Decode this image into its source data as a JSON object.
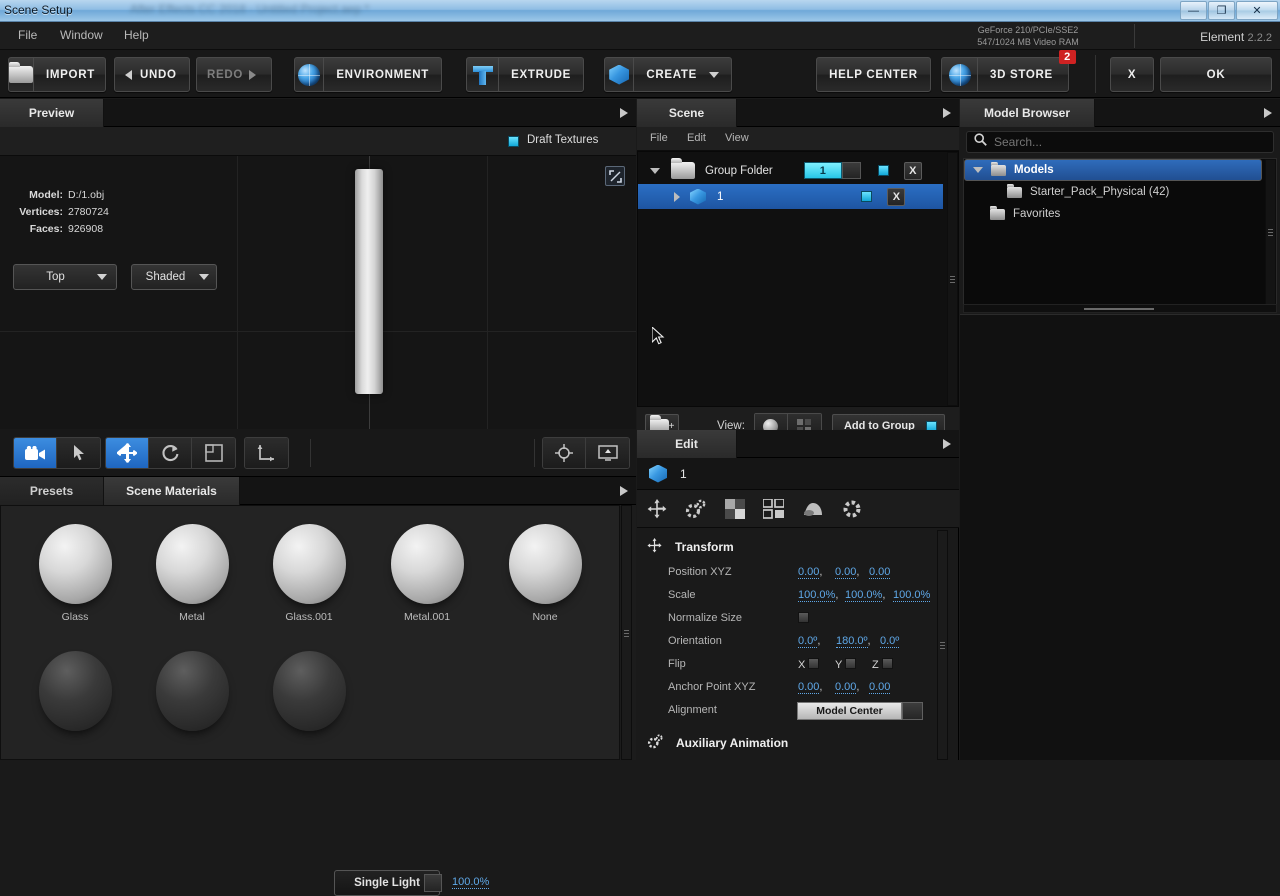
{
  "window": {
    "title": "Scene Setup",
    "ghost_title": "After Effects CC 2018 - Untitled Project.aep *",
    "minimize": "—",
    "maximize": "❐",
    "close": "✕"
  },
  "menubar": {
    "items": [
      "File",
      "Window",
      "Help"
    ]
  },
  "gpu": {
    "line1": "GeForce 210/PCIe/SSE2",
    "line2": "547/1024 MB Video RAM"
  },
  "product": {
    "name": "Element",
    "version": "2.2.2"
  },
  "toolbar": {
    "import": "IMPORT",
    "undo": "UNDO",
    "redo": "REDO",
    "environment": "ENVIRONMENT",
    "extrude": "EXTRUDE",
    "create": "CREATE",
    "help_center": "HELP CENTER",
    "store": "3D STORE",
    "store_badge": "2",
    "cancel": "X",
    "ok": "OK"
  },
  "preview": {
    "tab": "Preview",
    "draft_textures_label": "Draft Textures",
    "draft_textures_checked": true,
    "view_select": "Top",
    "shading_select": "Shaded",
    "info": [
      {
        "key": "Model:",
        "value": "D:/1.obj"
      },
      {
        "key": "Vertices:",
        "value": "2780724"
      },
      {
        "key": "Faces:",
        "value": "926908"
      }
    ]
  },
  "viewport_tools": {
    "light_select": "Single Light",
    "light_value": "100.0%",
    "icons": [
      "camera-icon",
      "select-arrow-icon",
      "move-icon",
      "rotate-icon",
      "scale-icon",
      "axis-icon",
      "target-icon",
      "screen-icon"
    ]
  },
  "presets": {
    "tabs": [
      "Presets",
      "Scene Materials"
    ],
    "active_tab": "Scene Materials",
    "materials_row1": [
      "Glass",
      "Metal",
      "Glass.001",
      "Metal.001",
      "None"
    ],
    "materials_row2": [
      "",
      "",
      ""
    ]
  },
  "scene": {
    "tab": "Scene",
    "menu": [
      "File",
      "Edit",
      "View"
    ],
    "rows": [
      {
        "name": "Group Folder",
        "type": "folder",
        "count": "1",
        "selected": false
      },
      {
        "name": "1",
        "type": "model",
        "selected": true
      }
    ],
    "footer": {
      "view_label": "View:",
      "add_to_group": "Add to Group"
    }
  },
  "edit": {
    "tab": "Edit",
    "object_name": "1",
    "icons": [
      "transform-icon",
      "animation-gear-icon",
      "materials-icon",
      "replicator-icon",
      "ambient-occlusion-icon",
      "settings-gear-icon"
    ],
    "transform": {
      "title": "Transform",
      "properties": [
        {
          "label": "Position XYZ",
          "type": "triple",
          "values": [
            "0.00",
            "0.00",
            "0.00"
          ]
        },
        {
          "label": "Scale",
          "type": "triple",
          "values": [
            "100.0%",
            "100.0%",
            "100.0%"
          ]
        },
        {
          "label": "Normalize Size",
          "type": "checkbox",
          "checked": false
        },
        {
          "label": "Orientation",
          "type": "triple",
          "values": [
            "0.0º",
            "180.0º",
            "0.0º"
          ]
        },
        {
          "label": "Flip",
          "type": "flip",
          "axes": [
            "X",
            "Y",
            "Z"
          ]
        },
        {
          "label": "Anchor Point XYZ",
          "type": "triple",
          "values": [
            "0.00",
            "0.00",
            "0.00"
          ]
        },
        {
          "label": "Alignment",
          "type": "select",
          "value": "Model Center"
        }
      ]
    },
    "aux_animation": {
      "title": "Auxiliary Animation"
    }
  },
  "browser": {
    "tab": "Model Browser",
    "search_placeholder": "Search...",
    "search_value": "",
    "tree": [
      {
        "label": "Models",
        "depth": 0,
        "selected": true,
        "expanded": true
      },
      {
        "label": "Starter_Pack_Physical (42)",
        "depth": 1,
        "selected": false
      },
      {
        "label": "Favorites",
        "depth": 0,
        "selected": false
      }
    ]
  },
  "colors": {
    "accent_blue": "#2f6cbb",
    "cyan": "#27c6e8",
    "link": "#5fa8e8",
    "badge_red": "#cf2222"
  }
}
